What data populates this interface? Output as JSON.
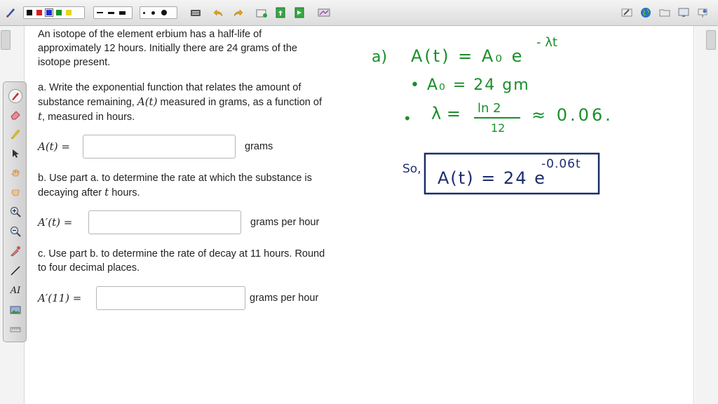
{
  "toolbar": {
    "colors": {
      "black": "#111111",
      "red": "#d62020",
      "blue": "#1d2fd6",
      "green": "#1a8f2a",
      "yellow": "#e8d321"
    },
    "selected_color": "blue",
    "icons": [
      "pen-tool-icon",
      "undo-icon",
      "redo-icon",
      "new-page-icon",
      "insert-page-icon",
      "export-page-icon",
      "screen-capture-icon",
      "highlighter-mode-icon",
      "web-icon",
      "folder-icon",
      "screen-icon",
      "settings-icon"
    ]
  },
  "palette": {
    "tools": [
      "pen-icon",
      "eraser-icon",
      "highlighter-icon",
      "pointer-icon",
      "hand-icon",
      "grab-icon",
      "zoom-in-icon",
      "zoom-out-icon",
      "eyedropper-icon",
      "line-icon",
      "text-tool-icon",
      "image-tool-icon",
      "ruler-icon"
    ],
    "text_tool_label": "AI"
  },
  "question": {
    "intro": "An isotope of the element erbium has a half-life of approximately 12 hours. Initially there are 24 grams of the isotope present.",
    "part_a_prompt_1": "a. Write the exponential function that relates the amount of substance remaining,",
    "part_a_var": "A(t)",
    "part_a_prompt_2": "measured in grams, as a function of",
    "part_a_t": "t",
    "part_a_prompt_3": ", measured in hours.",
    "part_a_lhs": "A(t) =",
    "part_a_unit": "grams",
    "part_a_value": "",
    "part_b_prompt_1": "b. Use part a. to determine the rate at which the substance is decaying after",
    "part_b_t": "t",
    "part_b_prompt_2": "hours.",
    "part_b_lhs": "A′(t) =",
    "part_b_unit": "grams per hour",
    "part_b_value": "",
    "part_c_prompt": "c. Use part b. to determine the rate of decay at 11 hours. Round to four decimal places.",
    "part_c_lhs": "A′(11) =",
    "part_c_unit": "grams per hour",
    "part_c_value": ""
  },
  "handwriting": {
    "ink_green": "#1a8f2a",
    "ink_blue": "#1c2d6e",
    "line1_label": "a)",
    "line1_lhs": "A(t) = A₀ e",
    "line1_exp": "- λt",
    "line2": "• A₀ = 24 gm",
    "line3_bullet": "•",
    "line3_lhs": "λ =",
    "line3_num": "ln 2",
    "line3_den": "12",
    "line3_approx": "≈ 0.06.",
    "line4_so": "So,",
    "line4_boxed": "A(t) = 24 e",
    "line4_exp": "-0.06t"
  }
}
